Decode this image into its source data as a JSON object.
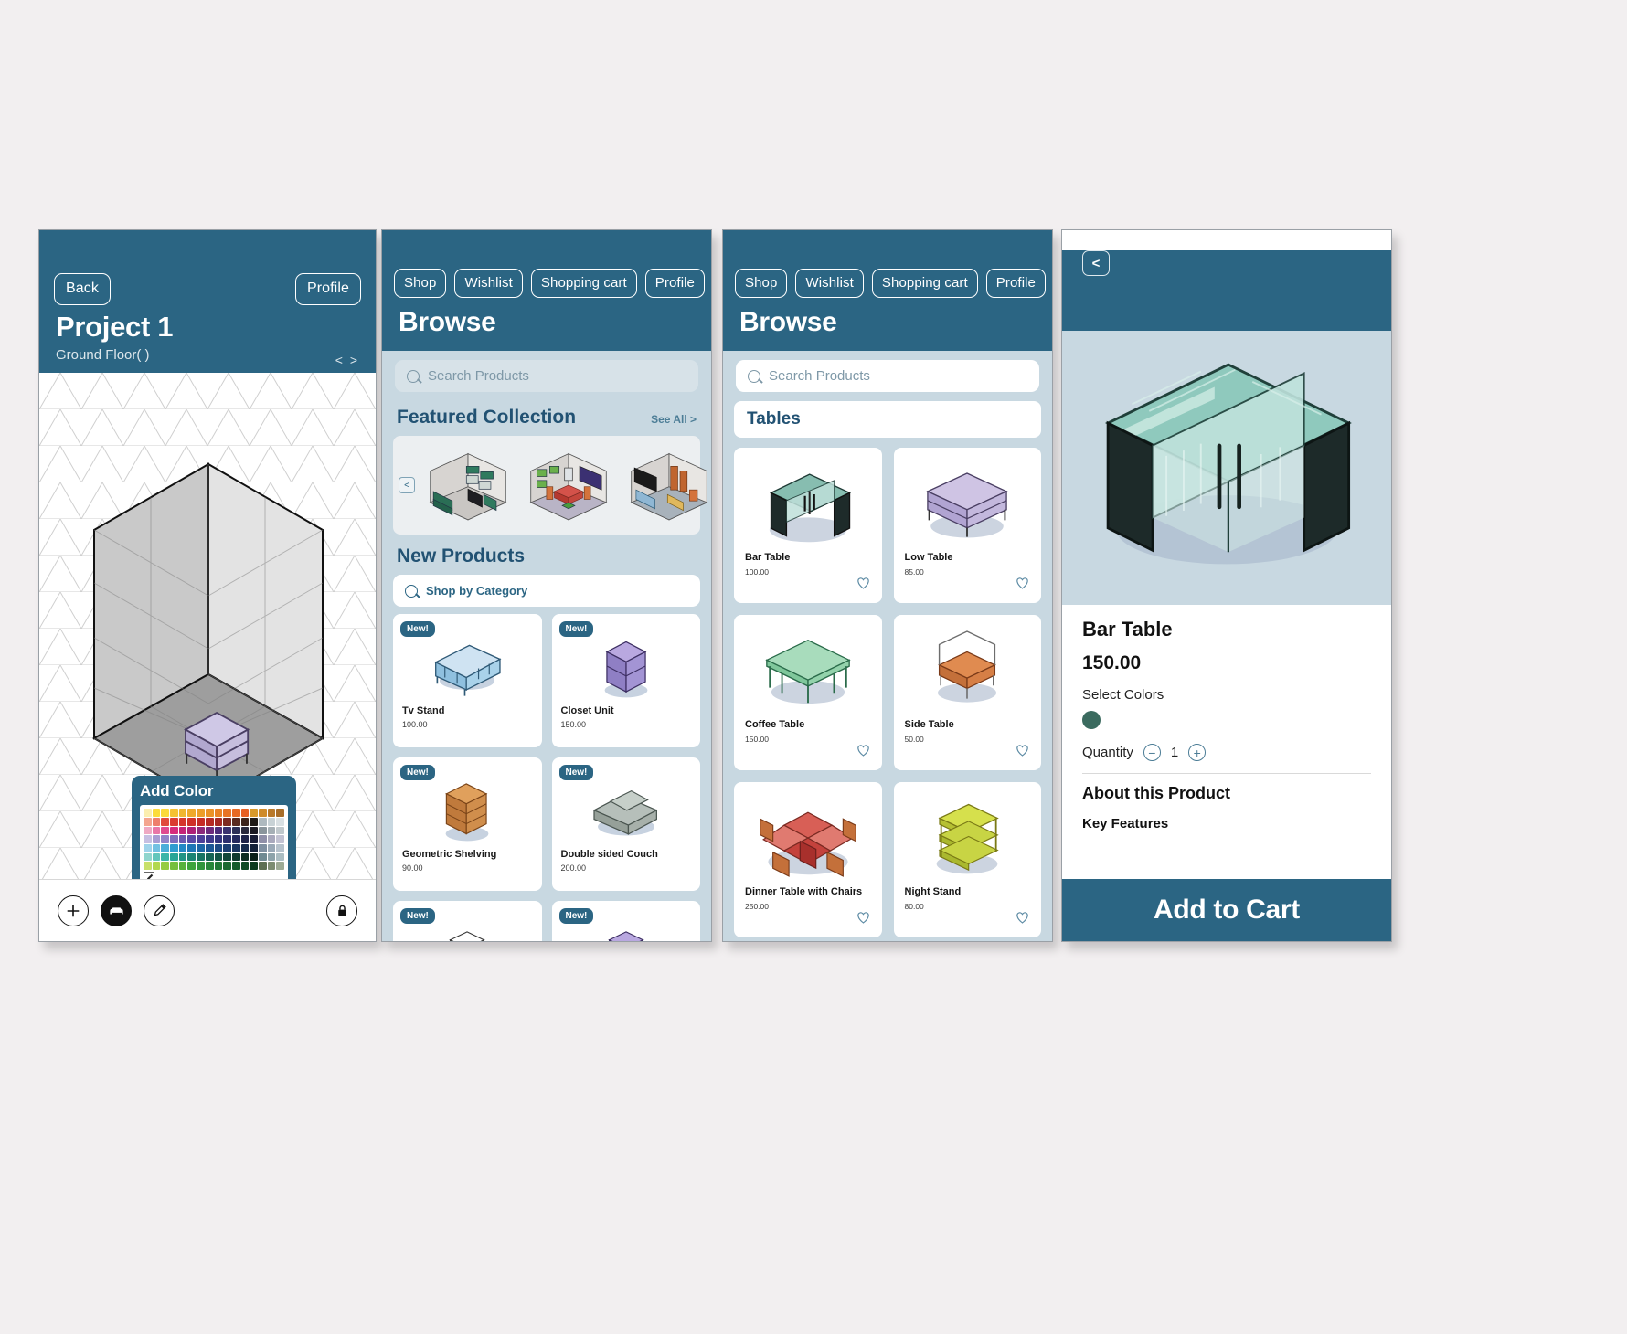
{
  "canvas": {
    "bg": "#f2eff0",
    "accent": "#2b6583",
    "panel_bg": "#c8d8e1"
  },
  "panel1": {
    "name": "project-editor",
    "back_label": "Back",
    "profile_label": "Profile",
    "title": "Project 1",
    "subtitle": "Ground Floor( )",
    "nav_arrows": "< >",
    "color_panel": {
      "title": "Add Color"
    },
    "toolbar": {
      "add_icon": "plus-icon",
      "furniture_icon": "couch-icon",
      "eyedropper_icon": "eyedropper-icon",
      "lock_icon": "lock-icon"
    }
  },
  "panel2": {
    "name": "browse-home",
    "tabs": [
      "Shop",
      "Wishlist",
      "Shopping cart",
      "Profile"
    ],
    "title": "Browse",
    "search_placeholder": "Search Products",
    "featured": {
      "heading": "Featured Collection",
      "see_all": "See All >",
      "prev": "<",
      "next": ">"
    },
    "new_products": {
      "heading": "New Products",
      "category_placeholder": "Shop by Category"
    },
    "badge": "New!",
    "products": [
      {
        "name": "Tv Stand",
        "price": "100.00",
        "color": "#9fc6dd",
        "art": "tvstand"
      },
      {
        "name": "Closet Unit",
        "price": "150.00",
        "color": "#8f7fc4",
        "art": "closet"
      },
      {
        "name": "Geometric Shelving",
        "price": "90.00",
        "color": "#d98a4e",
        "art": "shelf"
      },
      {
        "name": "Double sided Couch",
        "price": "200.00",
        "color": "#9aa6a2",
        "art": "couch"
      },
      {
        "name": "",
        "price": "",
        "color": "#ffffff",
        "art": "box"
      },
      {
        "name": "",
        "price": "",
        "color": "#8f7fc4",
        "art": "box2"
      }
    ]
  },
  "panel3": {
    "name": "browse-tables",
    "tabs": [
      "Shop",
      "Wishlist",
      "Shopping cart",
      "Profile"
    ],
    "title": "Browse",
    "search_placeholder": "Search Products",
    "category_title": "Tables",
    "products": [
      {
        "name": "Bar Table",
        "price": "100.00",
        "color": "#4f8a80",
        "art": "bartable"
      },
      {
        "name": "Low Table",
        "price": "85.00",
        "color": "#b9a8d6",
        "art": "lowtable"
      },
      {
        "name": "Coffee Table",
        "price": "150.00",
        "color": "#8fc9a4",
        "art": "coffee"
      },
      {
        "name": "Side Table",
        "price": "50.00",
        "color": "#d4733c",
        "art": "sidetable"
      },
      {
        "name": "Dinner Table with Chairs",
        "price": "250.00",
        "color": "#c94f4a",
        "art": "dinner"
      },
      {
        "name": "Night Stand",
        "price": "80.00",
        "color": "#c3d443",
        "art": "nightstand"
      },
      {
        "name": "",
        "price": "",
        "color": "#e0b85c",
        "art": "partial1"
      },
      {
        "name": "",
        "price": "",
        "color": "#4a7fd4",
        "art": "partial2"
      }
    ],
    "heart_icon": "heart-outline-icon"
  },
  "panel4": {
    "name": "product-detail",
    "back_label": "<",
    "product_name": "Bar Table",
    "price": "150.00",
    "colors_label": "Select Colors",
    "selected_color": "#3b6b5f",
    "quantity_label": "Quantity",
    "quantity_value": "1",
    "minus": "−",
    "plus": "+",
    "about_heading": "About this Product",
    "key_features": "Key Features",
    "add_to_cart": "Add to Cart"
  },
  "palette": {
    "rows": [
      [
        "#fbeeb0",
        "#fbdc3d",
        "#fbd93c",
        "#f5c233",
        "#f0b62f",
        "#efa92b",
        "#ec9e2a",
        "#ea9228",
        "#e98226",
        "#e87425",
        "#e76a24",
        "#e66024",
        "#d99a2b",
        "#cf8b2a",
        "#b9792a",
        "#a96e29"
      ],
      [
        "#f4a58f",
        "#ee7f6c",
        "#e04a3c",
        "#db3b31",
        "#d5352c",
        "#cf3028",
        "#c52c26",
        "#b52a24",
        "#a52823",
        "#7d2a22",
        "#5a2a1e",
        "#3c241b",
        "#1f1a17",
        "#aeb9bf",
        "#c8d2d6",
        "#d9e0e3"
      ],
      [
        "#efa9c3",
        "#e977a7",
        "#e04b90",
        "#d62a7c",
        "#c52378",
        "#ae2077",
        "#8d2a7b",
        "#6d2b7c",
        "#4c2d7a",
        "#3a3270",
        "#2d2f55",
        "#2a2a3c",
        "#1b1a23",
        "#8a959c",
        "#a6b0b6",
        "#c0c8cc"
      ],
      [
        "#c6bfe2",
        "#a99dd3",
        "#9384c8",
        "#7f6dbc",
        "#6b59b0",
        "#5a4aa6",
        "#4c4099",
        "#3f3a8c",
        "#34347e",
        "#2c2f6e",
        "#25295c",
        "#1f2448",
        "#191d35",
        "#8f8fa8",
        "#a9a9bd",
        "#c2c2d2"
      ],
      [
        "#9ed3ea",
        "#72c1e2",
        "#4aaed9",
        "#2f9dd0",
        "#2289c5",
        "#1d77b6",
        "#1b67a6",
        "#1b5795",
        "#1c4a84",
        "#1c3f72",
        "#1a355f",
        "#172b4b",
        "#142238",
        "#7f90a1",
        "#9aa9b7",
        "#b6c2cc"
      ],
      [
        "#8fd5cd",
        "#62c6bb",
        "#3bb5a8",
        "#28a596",
        "#1f9484",
        "#1a8473",
        "#177463",
        "#156454",
        "#135546",
        "#114739",
        "#0f392d",
        "#0d2c22",
        "#0a2018",
        "#6f8a92",
        "#8da3aa",
        "#abbdc2"
      ],
      [
        "#c8e06a",
        "#b2d84e",
        "#96cc43",
        "#76bf3e",
        "#57b23c",
        "#3da43c",
        "#2f963c",
        "#27873a",
        "#207836",
        "#1a6931",
        "#155a2b",
        "#104a25",
        "#0c3b1e",
        "#5c6f52",
        "#7d8d72",
        "#9eab95"
      ]
    ]
  }
}
